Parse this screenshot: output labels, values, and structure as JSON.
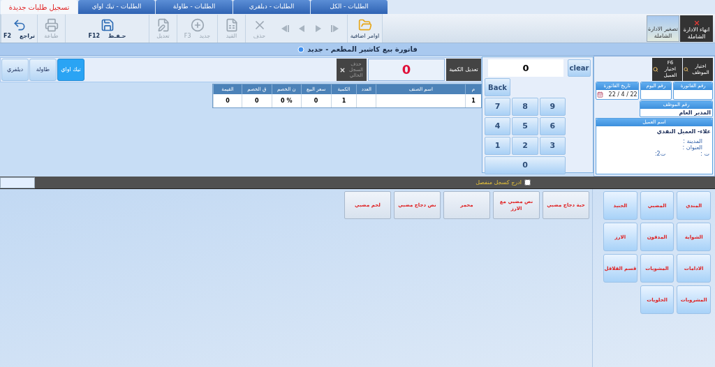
{
  "tabs": [
    {
      "label": "الطلبات - الكل",
      "selected": false
    },
    {
      "label": "الطلبات - دبلفري",
      "selected": false
    },
    {
      "label": "الطلبات - طاولة",
      "selected": false
    },
    {
      "label": "الطلبات - تيك اواي",
      "selected": false
    },
    {
      "label": "تسجيل طلبات جديدة",
      "selected": true
    }
  ],
  "toolbar": {
    "items": [
      {
        "kind": "folder",
        "label": "اوامر اضافية",
        "disabled": false
      },
      {
        "kind": "nav",
        "disabled": true
      },
      {
        "kind": "delete",
        "label": "حذف",
        "disabled": true
      },
      {
        "kind": "ledger",
        "label": "القيد",
        "disabled": true
      },
      {
        "kind": "new",
        "label": "جديد",
        "shortcut": "F3",
        "disabled": true
      },
      {
        "kind": "edit",
        "label": "تعديل",
        "disabled": true
      },
      {
        "kind": "save",
        "label": "حـفـظ",
        "shortcut": "F12",
        "disabled": false
      },
      {
        "kind": "print",
        "label": "طباعة",
        "disabled": true
      },
      {
        "kind": "undo",
        "label": "تراجع",
        "shortcut": "F2",
        "disabled": false
      }
    ],
    "window_buttons": [
      {
        "kind": "close",
        "label": "انهاء الادارة الشاملة"
      },
      {
        "kind": "minimize",
        "label": "تصغير الادارة الشاملة"
      }
    ]
  },
  "title": "فاتورة بيع كاشير المطعم - جديد",
  "customer_panel": {
    "buttons": [
      {
        "label": "اختيار الموظف"
      },
      {
        "shortcut": "F6",
        "label": "اختيار العميل"
      }
    ],
    "fields": [
      {
        "label": "رقم الفاتورة"
      },
      {
        "label": "رقم اليوم"
      },
      {
        "label": "تاريخ الفاتورة",
        "value": "22 / 4 / 22"
      }
    ],
    "employee": {
      "label": "رقم الموظف",
      "value": "المدير العام"
    },
    "customer": {
      "label": "اسم العميل",
      "name": "علاء- العميل النقدي",
      "lines": [
        "المدينة :",
        "العنوان :"
      ],
      "phone": "ت :",
      "phone2": "ت2:"
    }
  },
  "numpad": {
    "display": "0",
    "clear": "clear",
    "back": "Back",
    "keys": [
      "9",
      "8",
      "7",
      "6",
      "5",
      "4",
      "3",
      "2",
      "1",
      "0"
    ]
  },
  "quantity": {
    "button": "تعديل الكمية",
    "value": "0",
    "delete_button": {
      "label": "حذف السجل الحالي",
      "disabled": true
    }
  },
  "order_types": [
    {
      "label": "تيك اواي",
      "selected": true
    },
    {
      "label": "طاولة",
      "selected": false
    },
    {
      "label": "ديلفري",
      "selected": false
    }
  ],
  "table": {
    "columns": [
      "م",
      "اسم الصنف",
      "العدد",
      "الكمية",
      "سعر البيع",
      "ن الخصم",
      "ق الخصم",
      "القيمة"
    ],
    "rows": [
      [
        "1",
        null,
        null,
        "1",
        "0",
        "0 %",
        "0",
        "0"
      ]
    ]
  },
  "separate_record": {
    "label": "ادرج كسجل منفصل",
    "checked": false
  },
  "categories": [
    "المندي",
    "المضبي",
    "الحنيذ",
    "الشواية",
    "المدفون",
    "الارز",
    "الادامات",
    "المشويات",
    "قسم الفلافل",
    "المشروبات",
    "الحلويات"
  ],
  "items": [
    "حبة دجاج مضبي",
    "نص مضبي مع الارز",
    "محمر",
    "نص دجاج مضبي",
    "لحم مضبي"
  ]
}
